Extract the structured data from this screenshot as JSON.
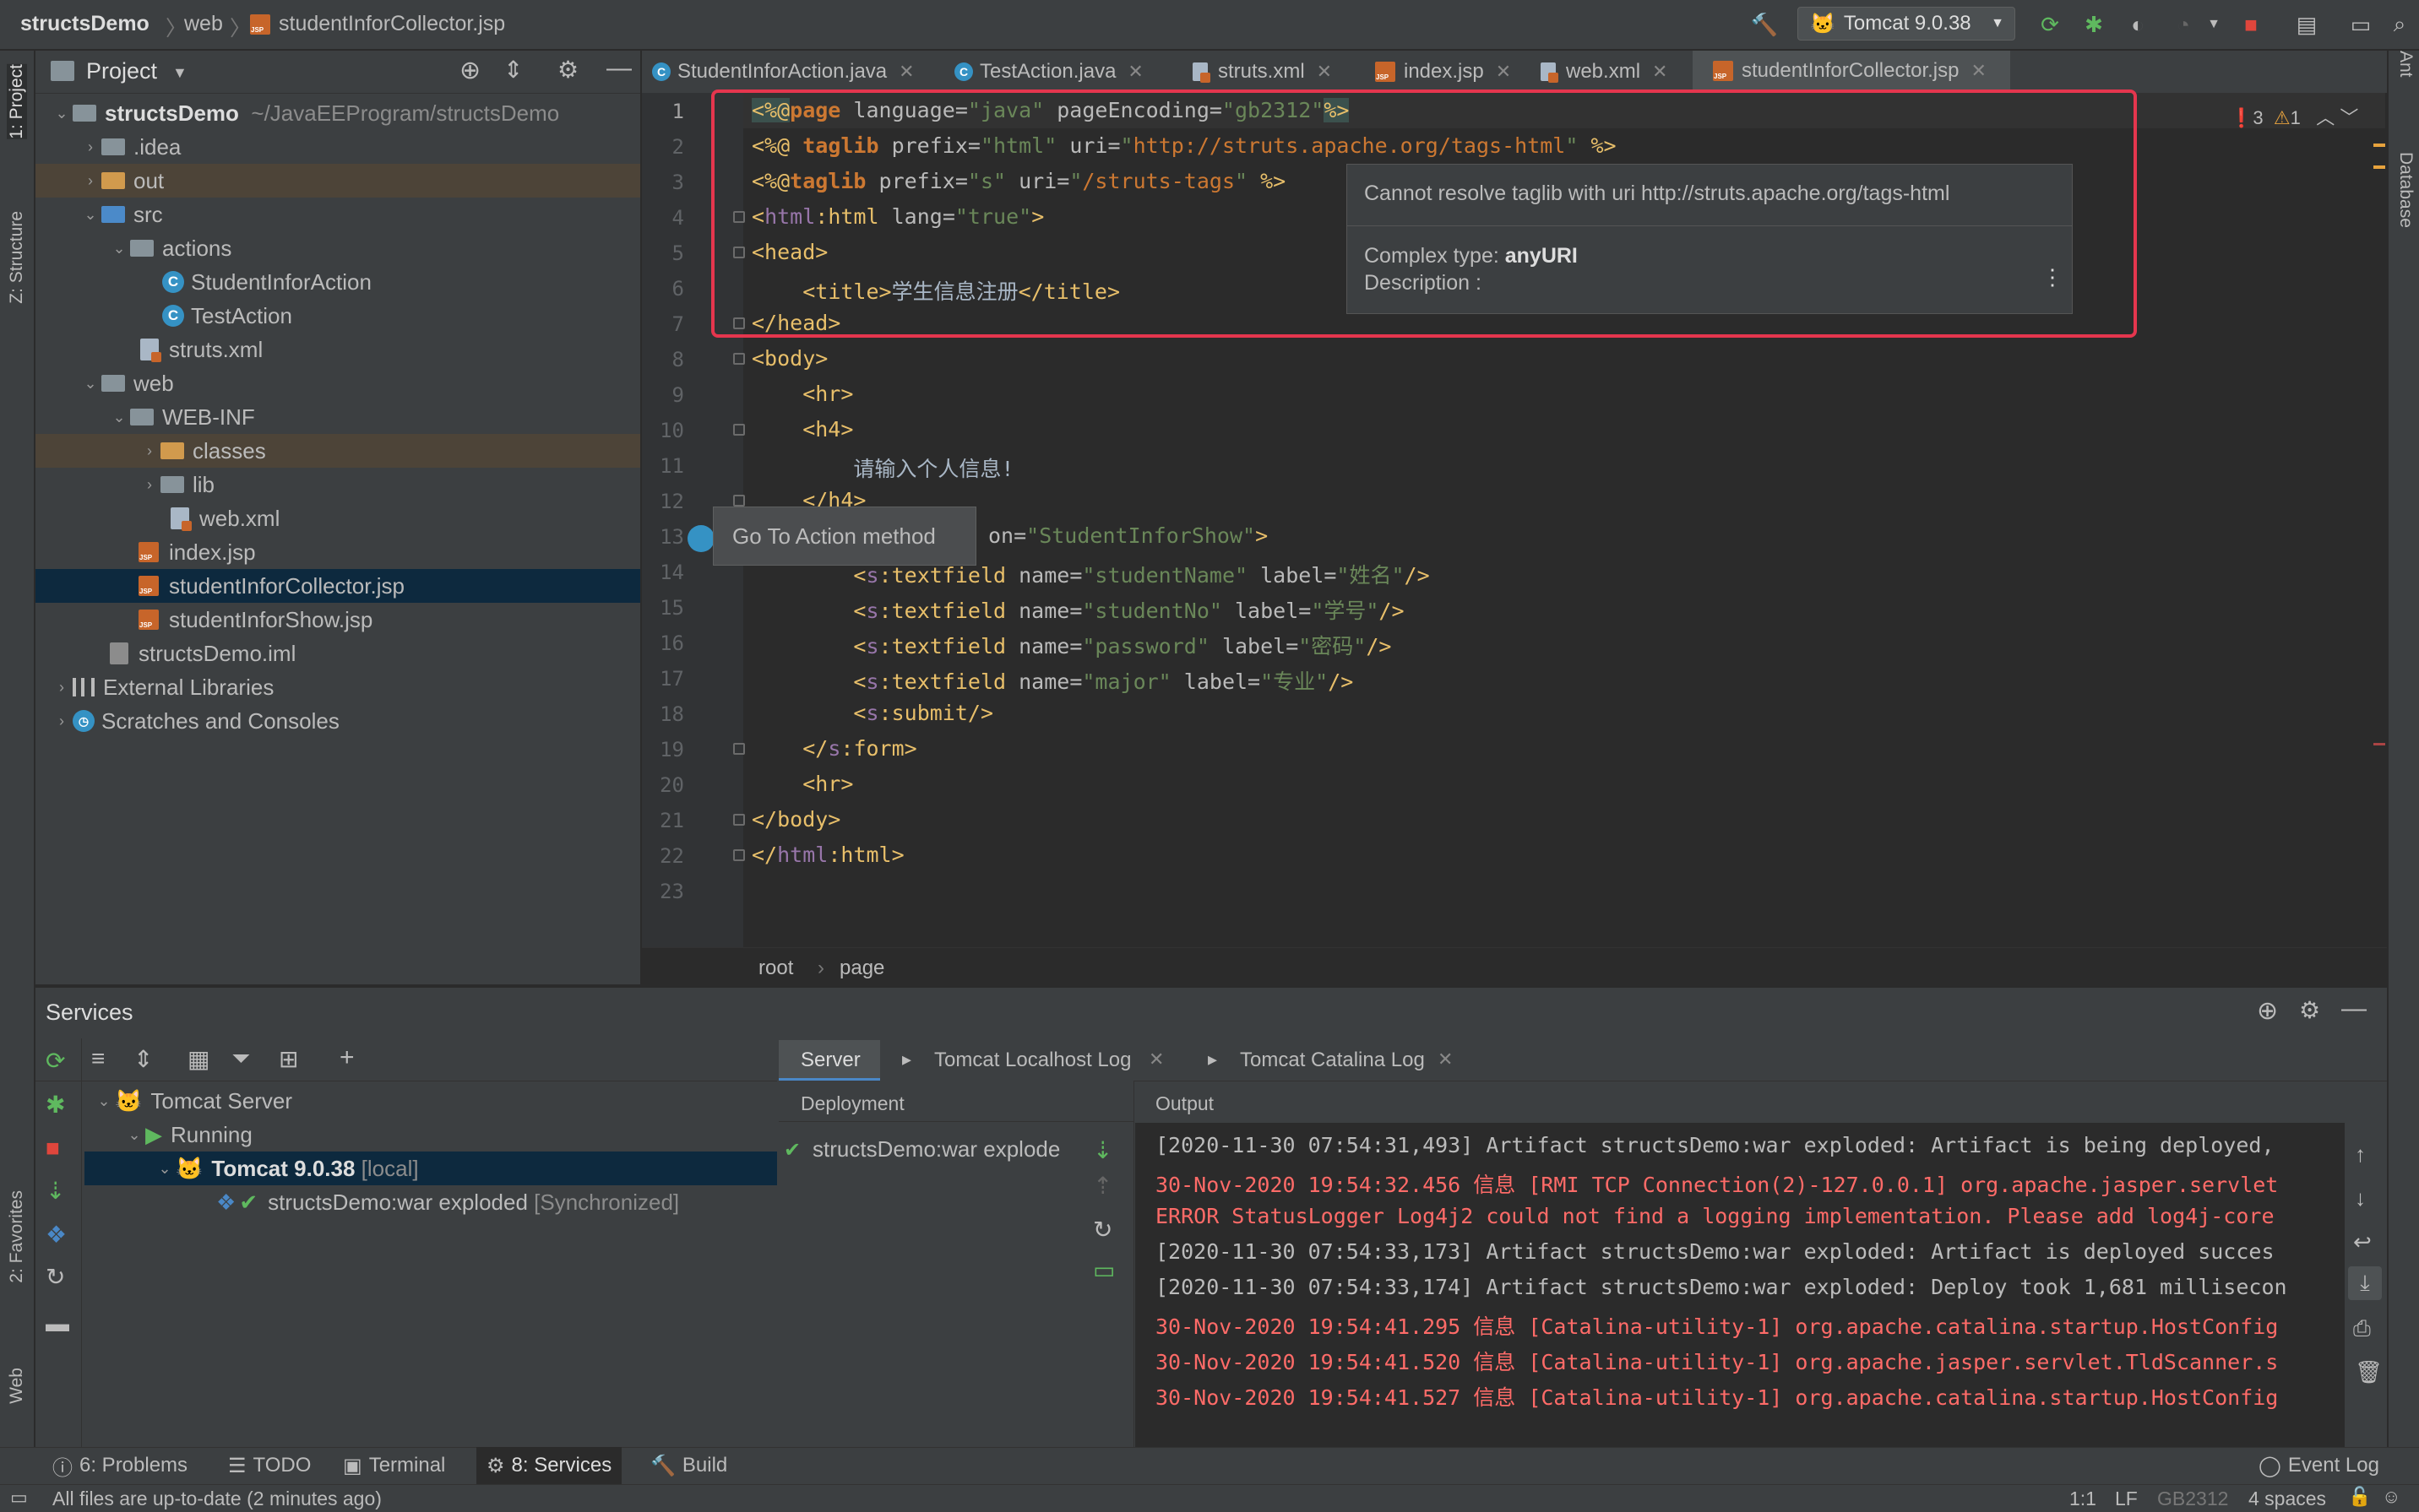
{
  "nav": {
    "project": "structsDemo",
    "folder": "web",
    "file": "studentInforCollector.jsp",
    "run_config": "Tomcat 9.0.38"
  },
  "left_strip": {
    "project": "1: Project",
    "structure": "Z: Structure",
    "favorites": "2: Favorites",
    "web": "Web"
  },
  "right_strip": {
    "ant": "Ant",
    "database": "Database"
  },
  "project_panel": {
    "title": "Project",
    "tree": [
      {
        "label": "structsDemo",
        "path": "~/JavaEEProgram/structsDemo"
      },
      {
        "label": ".idea"
      },
      {
        "label": "out"
      },
      {
        "label": "src"
      },
      {
        "label": "actions"
      },
      {
        "label": "StudentInforAction"
      },
      {
        "label": "TestAction"
      },
      {
        "label": "struts.xml"
      },
      {
        "label": "web"
      },
      {
        "label": "WEB-INF"
      },
      {
        "label": "classes"
      },
      {
        "label": "lib"
      },
      {
        "label": "web.xml"
      },
      {
        "label": "index.jsp"
      },
      {
        "label": "studentInforCollector.jsp"
      },
      {
        "label": "studentInforShow.jsp"
      },
      {
        "label": "structsDemo.iml"
      },
      {
        "label": "External Libraries"
      },
      {
        "label": "Scratches and Consoles"
      }
    ]
  },
  "tabs": [
    {
      "label": "StudentInforAction.java"
    },
    {
      "label": "TestAction.java"
    },
    {
      "label": "struts.xml"
    },
    {
      "label": "index.jsp"
    },
    {
      "label": "web.xml"
    },
    {
      "label": "studentInforCollector.jsp"
    }
  ],
  "editor": {
    "line_numbers": [
      "1",
      "2",
      "3",
      "4",
      "5",
      "6",
      "7",
      "8",
      "9",
      "10",
      "11",
      "12",
      "13",
      "14",
      "15",
      "16",
      "17",
      "18",
      "19",
      "20",
      "21",
      "22",
      "23"
    ],
    "line1": {
      "open": "<%@",
      "page": "page",
      "rest": " language=",
      "v1": "\"java\"",
      "a2": " pageEncoding=",
      "v2": "\"gb2312\"",
      "close": "%>"
    },
    "line2": {
      "open": "<%@ ",
      "taglib": "taglib",
      "a1": " prefix=",
      "v1": "\"html\"",
      "a2": " uri=",
      "q1": "\"",
      "url": "http://struts.apache.org/tags-html",
      "q2": "\"",
      "close": " %>"
    },
    "line3": {
      "open": "<%@",
      "taglib": "taglib",
      "a1": " prefix=",
      "v1": "\"s\"",
      "a2": " uri=",
      "q1": "\"",
      "url": "/struts-tags",
      "q2": "\"",
      "close": " %>"
    },
    "line4": {
      "lt": "<",
      "ns": "html",
      "colon": ":",
      "tag": "html",
      "a1": " lang=",
      "v1": "\"true\"",
      "gt": ">"
    },
    "line5": "<head>",
    "line6": {
      "indent": "    ",
      "open": "<title>",
      "text": "学生信息注册",
      "close": "</title>"
    },
    "line7": "</head>",
    "line8": "<body>",
    "line9": "    <hr>",
    "line10": "    <h4>",
    "line11": "        请输入个人信息!",
    "line12": "    </h4>",
    "line13": {
      "tail": "on=",
      "v": "\"StudentInforShow\"",
      "gt": ">"
    },
    "line14": {
      "indent": "        ",
      "lt": "<",
      "ns": "s",
      "tag": ":textfield",
      "a1": " name=",
      "v1": "\"studentName\"",
      "a2": " label=",
      "v2": "\"姓名\"",
      "end": "/>"
    },
    "line15": {
      "indent": "        ",
      "lt": "<",
      "ns": "s",
      "tag": ":textfield",
      "a1": " name=",
      "v1": "\"studentNo\"",
      "a2": " label=",
      "v2": "\"学号\"",
      "end": "/>"
    },
    "line16": {
      "indent": "        ",
      "lt": "<",
      "ns": "s",
      "tag": ":textfield",
      "a1": " name=",
      "v1": "\"password\"",
      "a2": " label=",
      "v2": "\"密码\"",
      "end": "/>"
    },
    "line17": {
      "indent": "        ",
      "lt": "<",
      "ns": "s",
      "tag": ":textfield",
      "a1": " name=",
      "v1": "\"major\"",
      "a2": " label=",
      "v2": "\"专业\"",
      "end": "/>"
    },
    "line18": {
      "indent": "        ",
      "lt": "<",
      "ns": "s",
      "tag": ":submit",
      "end": "/>"
    },
    "line19": {
      "indent": "    ",
      "lt": "</",
      "ns": "s",
      "tag": ":form",
      "gt": ">"
    },
    "line20": "    <hr>",
    "line21": "</body>",
    "line22": {
      "lt": "</",
      "ns": "html",
      "colon": ":",
      "tag": "html",
      "gt": ">"
    },
    "errors": "3",
    "warnings": "1"
  },
  "tooltip": {
    "message": "Cannot resolve taglib with uri http://struts.apache.org/tags-html",
    "type_label": "Complex type: ",
    "type_value": "anyURI",
    "description": "Description :"
  },
  "goto_action": "Go To Action method",
  "breadcrumb": {
    "a": "root",
    "b": "page"
  },
  "services": {
    "title": "Services",
    "tree": {
      "server": "Tomcat Server",
      "running": "Running",
      "instance": "Tomcat 9.0.38",
      "instance_tag": "[local]",
      "artifact": "structsDemo:war exploded",
      "artifact_tag": "[Synchronized]"
    },
    "tabs": {
      "server": "Server",
      "localhost_log": "Tomcat Localhost Log",
      "catalina_log": "Tomcat Catalina Log"
    },
    "deployment_header": "Deployment",
    "deployment_item": "structsDemo:war explode",
    "output_header": "Output",
    "output_lines": [
      "[2020-11-30 07:54:31,493] Artifact structsDemo:war exploded: Artifact is being deployed,",
      "30-Nov-2020 19:54:32.456 信息 [RMI TCP Connection(2)-127.0.0.1] org.apache.jasper.servlet",
      "ERROR StatusLogger Log4j2 could not find a logging implementation. Please add log4j-core",
      "[2020-11-30 07:54:33,173] Artifact structsDemo:war exploded: Artifact is deployed succes",
      "[2020-11-30 07:54:33,174] Artifact structsDemo:war exploded: Deploy took 1,681 millisecon",
      "30-Nov-2020 19:54:41.295 信息 [Catalina-utility-1] org.apache.catalina.startup.HostConfig",
      "30-Nov-2020 19:54:41.520 信息 [Catalina-utility-1] org.apache.jasper.servlet.TldScanner.s",
      "30-Nov-2020 19:54:41.527 信息 [Catalina-utility-1] org.apache.catalina.startup.HostConfig"
    ]
  },
  "bottom_tabs": {
    "problems": "6: Problems",
    "todo": "TODO",
    "terminal": "Terminal",
    "services": "8: Services",
    "build": "Build",
    "event_log": "Event Log"
  },
  "status": {
    "message": "All files are up-to-date (2 minutes ago)",
    "position": "1:1",
    "line_sep": "LF",
    "encoding": "GB2312",
    "indent": "4 spaces"
  },
  "colors": {
    "accent": "#4a88c7",
    "error": "#e5364e",
    "log_red": "#ff6b68"
  }
}
